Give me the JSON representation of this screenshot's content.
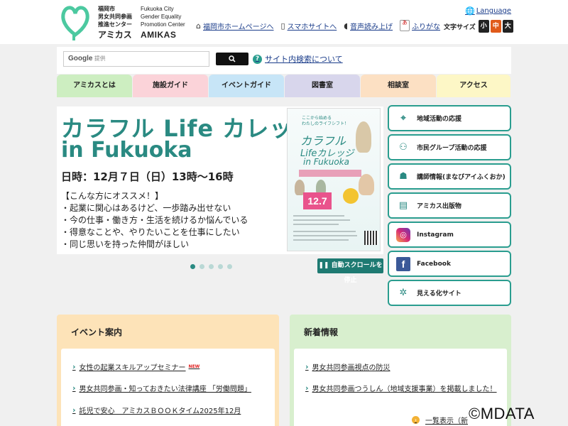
{
  "header": {
    "logo_jp_lines": [
      "福岡市",
      "男女共同参画",
      "推進センター"
    ],
    "logo_jp_name": "アミカス",
    "logo_en_lines": [
      "Fukuoka City",
      "Gender Equality",
      "Promotion Center"
    ],
    "logo_en_name": "AMIKAS",
    "language_label": "Language",
    "util_links": [
      "福岡市ホームページへ",
      "スマホサイトへ",
      "音声読み上げ",
      "ふりがな"
    ],
    "furigana_icon_text": "あ",
    "fontsize_label": "文字サイズ",
    "fontsize_options": [
      "小",
      "中",
      "大"
    ],
    "fontsize_colors": [
      "#222222",
      "#e05a1a",
      "#222222"
    ]
  },
  "search": {
    "placeholder_brand": "Google",
    "placeholder_suffix": "提供",
    "button_icon": "search-icon",
    "about_icon_text": "?",
    "about_label": "サイト内検索について"
  },
  "nav": {
    "tabs": [
      {
        "label": "アミカスとは",
        "color": "#cdeec1"
      },
      {
        "label": "施設ガイド",
        "color": "#fbd3d9"
      },
      {
        "label": "イベントガイド",
        "color": "#c7e5f7"
      },
      {
        "label": "図書室",
        "color": "#d8d6ec"
      },
      {
        "label": "相談室",
        "color": "#fce0c3"
      },
      {
        "label": "アクセス",
        "color": "#fdf7c6"
      }
    ]
  },
  "hero": {
    "title_line1": "カラフル Life カレッジ",
    "title_line2": "in Fukuoka",
    "date": "日時：12月７日（日）13時〜16時",
    "lines": [
      "【こんな方にオススメ！】",
      "・起業に関心はあるけど、一歩踏み出せない",
      "・今の仕事・働き方・生活を続けるか悩んでいる",
      "・得意なことや、やりたいことを仕事にしたい",
      "・同じ思いを持った仲間がほしい"
    ],
    "poster": {
      "tagline_1": "ここから始める",
      "tagline_2": "わたしのライフシフト！",
      "title_1": "カラフル",
      "title_2": "Lifeカレッジ",
      "title_3": "in Fukuoka",
      "date": "12.7"
    },
    "slide_count": 5,
    "active_slide": 0,
    "autoplay_stop_label": "自動スクロールを停止"
  },
  "side_links": [
    {
      "label": "地域活動の応援",
      "icon": "map-pin-icon"
    },
    {
      "label": "市民グループ活動の応援",
      "icon": "group-icon"
    },
    {
      "label": "講師情報(まなびアイふくおか)",
      "icon": "lecturer-icon"
    },
    {
      "label": "アミカス出版物",
      "icon": "book-icon"
    },
    {
      "label": "Instagram",
      "icon": "instagram-icon"
    },
    {
      "label": "Facebook",
      "icon": "facebook-icon"
    },
    {
      "label": "見える化サイト",
      "icon": "visualize-icon"
    }
  ],
  "events": {
    "heading": "イベント案内",
    "items": [
      {
        "label": "女性の起業スキルアップセミナー",
        "new": "NEW"
      },
      {
        "label": "男女共同参画・知っておきたい法律講座 「労働問題」",
        "new": ""
      },
      {
        "label": "託児で安心　アミカスＢＯＯＫタイム2025年12月",
        "new": ""
      }
    ]
  },
  "news": {
    "heading": "新着情報",
    "items": [
      {
        "label": "男女共同参画視点の防災"
      },
      {
        "label": "男女共同参画つうしん（地域支援事業）を掲載しました！"
      }
    ],
    "more_label": "一覧表示（新"
  },
  "watermark": "©MDATA"
}
